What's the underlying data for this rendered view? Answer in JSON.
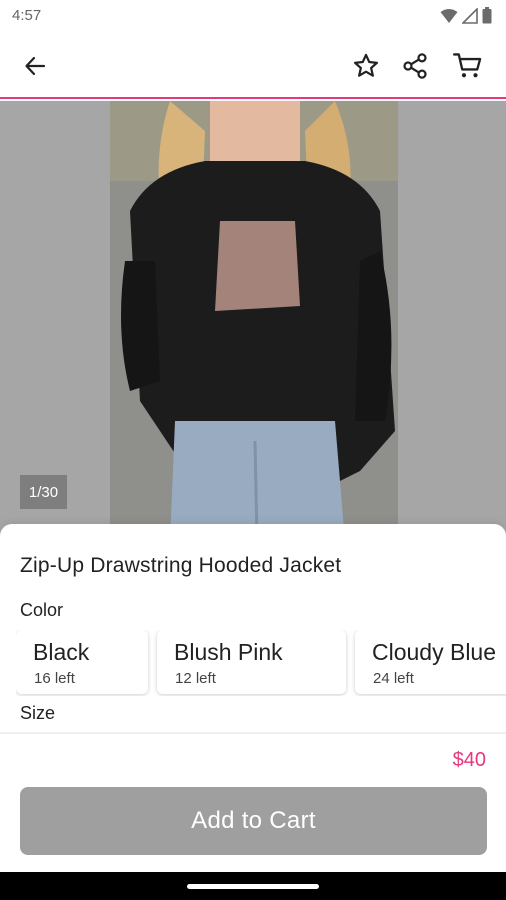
{
  "status_bar": {
    "time": "4:57"
  },
  "gallery": {
    "counter": "1/30"
  },
  "product": {
    "title": "Zip-Up Drawstring Hooded Jacket",
    "price": "$40"
  },
  "color": {
    "label": "Color",
    "options": [
      {
        "name": "Black",
        "stock": "16 left"
      },
      {
        "name": "Blush Pink",
        "stock": "12 left"
      },
      {
        "name": "Cloudy Blue",
        "stock": "24 left"
      }
    ]
  },
  "size": {
    "label": "Size"
  },
  "actions": {
    "add_to_cart": "Add to Cart"
  },
  "colors": {
    "accent": "#e7387e",
    "button_disabled": "#9f9f9f"
  }
}
